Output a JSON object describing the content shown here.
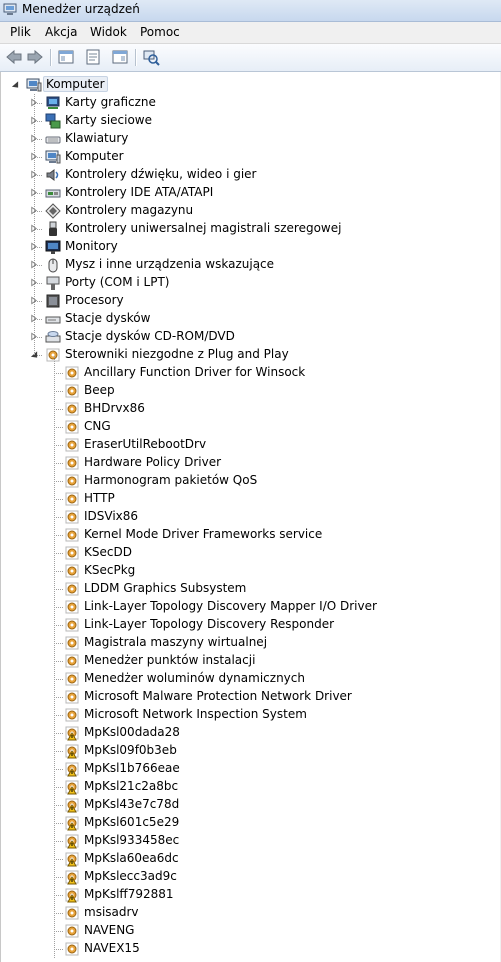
{
  "window": {
    "title": "Menedżer urządzeń"
  },
  "menu": [
    "Plik",
    "Akcja",
    "Widok",
    "Pomoc"
  ],
  "toolbar": {
    "buttons": [
      "back-icon",
      "forward-icon",
      "show-hide-console-tree-icon",
      "properties-icon",
      "help-pane-icon",
      "scan-hardware-icon"
    ]
  },
  "tree": {
    "root": {
      "label": "Komputer",
      "icon": "computer-icon",
      "expanded": true
    },
    "categories": [
      {
        "label": "Karty graficzne",
        "icon": "display-adapter-icon"
      },
      {
        "label": "Karty sieciowe",
        "icon": "network-adapter-icon"
      },
      {
        "label": "Klawiatury",
        "icon": "keyboard-icon"
      },
      {
        "label": "Komputer",
        "icon": "computer-icon"
      },
      {
        "label": "Kontrolery dźwięku, wideo i gier",
        "icon": "sound-icon"
      },
      {
        "label": "Kontrolery IDE ATA/ATAPI",
        "icon": "ide-controller-icon"
      },
      {
        "label": "Kontrolery magazynu",
        "icon": "storage-controller-icon"
      },
      {
        "label": "Kontrolery uniwersalnej magistrali szeregowej",
        "icon": "usb-icon"
      },
      {
        "label": "Monitory",
        "icon": "monitor-icon"
      },
      {
        "label": "Mysz i inne urządzenia wskazujące",
        "icon": "mouse-icon"
      },
      {
        "label": "Porty (COM i LPT)",
        "icon": "port-icon"
      },
      {
        "label": "Procesory",
        "icon": "processor-icon"
      },
      {
        "label": "Stacje dysków",
        "icon": "disk-drive-icon"
      },
      {
        "label": "Stacje dysków CD-ROM/DVD",
        "icon": "dvd-drive-icon"
      },
      {
        "label": "Sterowniki niezgodne z Plug and Play",
        "icon": "non-pnp-driver-icon",
        "expanded": true
      }
    ],
    "drivers": [
      {
        "label": "Ancillary Function Driver for Winsock",
        "warning": false
      },
      {
        "label": "Beep",
        "warning": false
      },
      {
        "label": "BHDrvx86",
        "warning": false
      },
      {
        "label": "CNG",
        "warning": false
      },
      {
        "label": "EraserUtilRebootDrv",
        "warning": false
      },
      {
        "label": "Hardware Policy Driver",
        "warning": false
      },
      {
        "label": "Harmonogram pakietów QoS",
        "warning": false
      },
      {
        "label": "HTTP",
        "warning": false
      },
      {
        "label": "IDSVix86",
        "warning": false
      },
      {
        "label": "Kernel Mode Driver Frameworks service",
        "warning": false
      },
      {
        "label": "KSecDD",
        "warning": false
      },
      {
        "label": "KSecPkg",
        "warning": false
      },
      {
        "label": "LDDM Graphics Subsystem",
        "warning": false
      },
      {
        "label": "Link-Layer Topology Discovery Mapper I/O Driver",
        "warning": false
      },
      {
        "label": "Link-Layer Topology Discovery Responder",
        "warning": false
      },
      {
        "label": "Magistrala maszyny wirtualnej",
        "warning": false
      },
      {
        "label": "Menedżer punktów instalacji",
        "warning": false
      },
      {
        "label": "Menedżer woluminów dynamicznych",
        "warning": false
      },
      {
        "label": "Microsoft Malware Protection Network Driver",
        "warning": false
      },
      {
        "label": "Microsoft Network Inspection System",
        "warning": false
      },
      {
        "label": "MpKsl00dada28",
        "warning": true
      },
      {
        "label": "MpKsl09f0b3eb",
        "warning": true
      },
      {
        "label": "MpKsl1b766eae",
        "warning": true
      },
      {
        "label": "MpKsl21c2a8bc",
        "warning": true
      },
      {
        "label": "MpKsl43e7c78d",
        "warning": true
      },
      {
        "label": "MpKsl601c5e29",
        "warning": true
      },
      {
        "label": "MpKsl933458ec",
        "warning": true
      },
      {
        "label": "MpKsla60ea6dc",
        "warning": true
      },
      {
        "label": "MpKslecc3ad9c",
        "warning": true
      },
      {
        "label": "MpKslff792881",
        "warning": true
      },
      {
        "label": "msisadrv",
        "warning": false
      },
      {
        "label": "NAVENG",
        "warning": false
      },
      {
        "label": "NAVEX15",
        "warning": false
      }
    ]
  },
  "colors": {
    "warning": "#f2c21a",
    "selection": "#e9eef5",
    "driver_gear": "#e8a33a"
  }
}
